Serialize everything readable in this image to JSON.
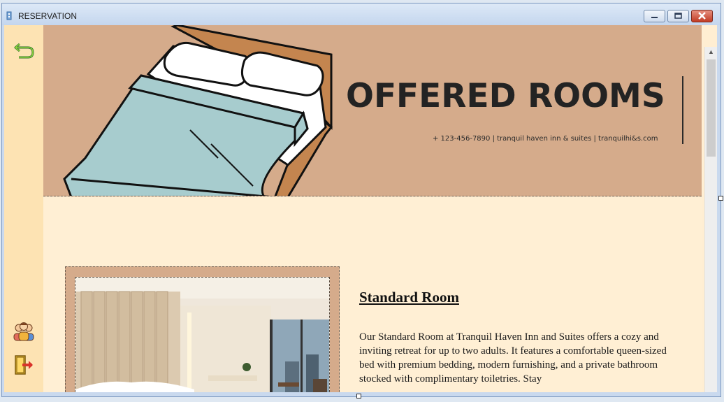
{
  "window": {
    "title": "RESERVATION",
    "controls": [
      "minimize",
      "maximize",
      "close"
    ]
  },
  "sidebar": {
    "icons": [
      "back-arrow-icon",
      "guests-icon",
      "exit-door-icon"
    ]
  },
  "banner": {
    "heading": "OFFERED ROOMS",
    "contact": "+ 123-456-7890  |  tranquil haven inn & suites  |  tranquilhi&s.com",
    "image": "bed-illustration"
  },
  "room": {
    "title": "Standard Room",
    "description": "Our Standard Room at Tranquil Haven Inn and Suites offers a cozy and inviting retreat for up to two adults. It features a comfortable queen-sized bed with premium bedding, modern furnishing, and a private bathroom stocked with complimentary toiletries. Stay",
    "image": "hotel-room-photo"
  },
  "colors": {
    "banner": "#d5ab8b",
    "sidebar": "#fde3b3",
    "content": "#ffefd4",
    "bed_sheet": "#a7ccce",
    "bed_frame": "#c4854f"
  }
}
